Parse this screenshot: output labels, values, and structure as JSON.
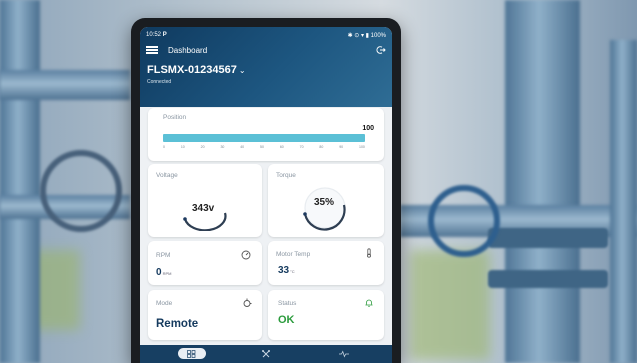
{
  "statusbar": {
    "time": "10:52",
    "app_icon": "P",
    "battery": "100%"
  },
  "header": {
    "title": "Dashboard",
    "device": "FLSMX-01234567",
    "connection": "Connected"
  },
  "position": {
    "label": "Position",
    "value": "100",
    "fill_percent": 100,
    "ticks": [
      "0",
      "10",
      "20",
      "30",
      "40",
      "50",
      "60",
      "70",
      "80",
      "90",
      "100"
    ]
  },
  "voltage": {
    "label": "Voltage",
    "value": "343v"
  },
  "torque": {
    "label": "Torque",
    "value": "35%"
  },
  "rpm": {
    "label": "RPM",
    "value": "0",
    "unit": "RPM"
  },
  "motor_temp": {
    "label": "Motor Temp",
    "value": "33",
    "unit": "°C"
  },
  "mode": {
    "label": "Mode",
    "value": "Remote"
  },
  "status": {
    "label": "Status",
    "value": "OK"
  },
  "colors": {
    "accent": "#5bc0d6",
    "header": "#1d5680",
    "ok": "#2b9b3c"
  }
}
